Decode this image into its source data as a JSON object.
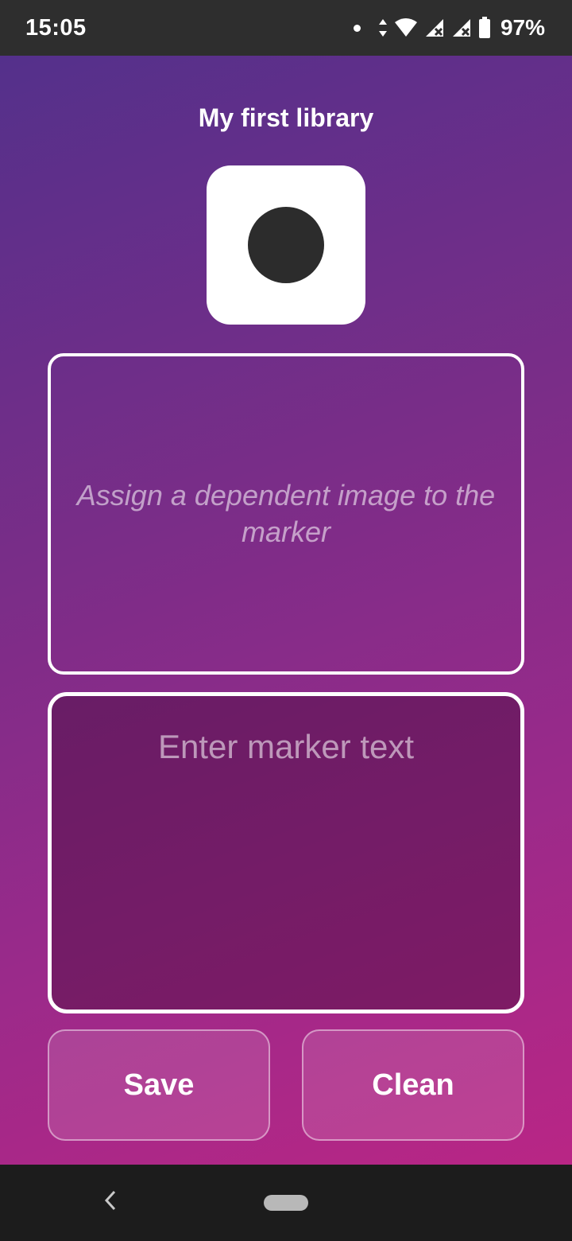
{
  "status_bar": {
    "time": "15:05",
    "battery": "97%",
    "icons": [
      "notification-dot-icon",
      "data-arrows-icon",
      "wifi-icon",
      "signal-icon",
      "signal-icon",
      "battery-icon"
    ]
  },
  "page": {
    "title": "My first library"
  },
  "marker": {
    "tile_color": "#ffffff",
    "dot_color": "#2c2c2c"
  },
  "image_box": {
    "hint": "Assign a dependent image to the marker"
  },
  "text_box": {
    "placeholder": "Enter marker text",
    "value": ""
  },
  "buttons": {
    "save_label": "Save",
    "clean_label": "Clean"
  },
  "navigation": {
    "back_icon": "back-chevron-icon",
    "home_icon": "home-pill-icon"
  },
  "colors": {
    "gradient_start": "#54308b",
    "gradient_end": "#b92685",
    "status_bar": "#2e2e2e",
    "nav_bar": "#1c1c1c"
  }
}
